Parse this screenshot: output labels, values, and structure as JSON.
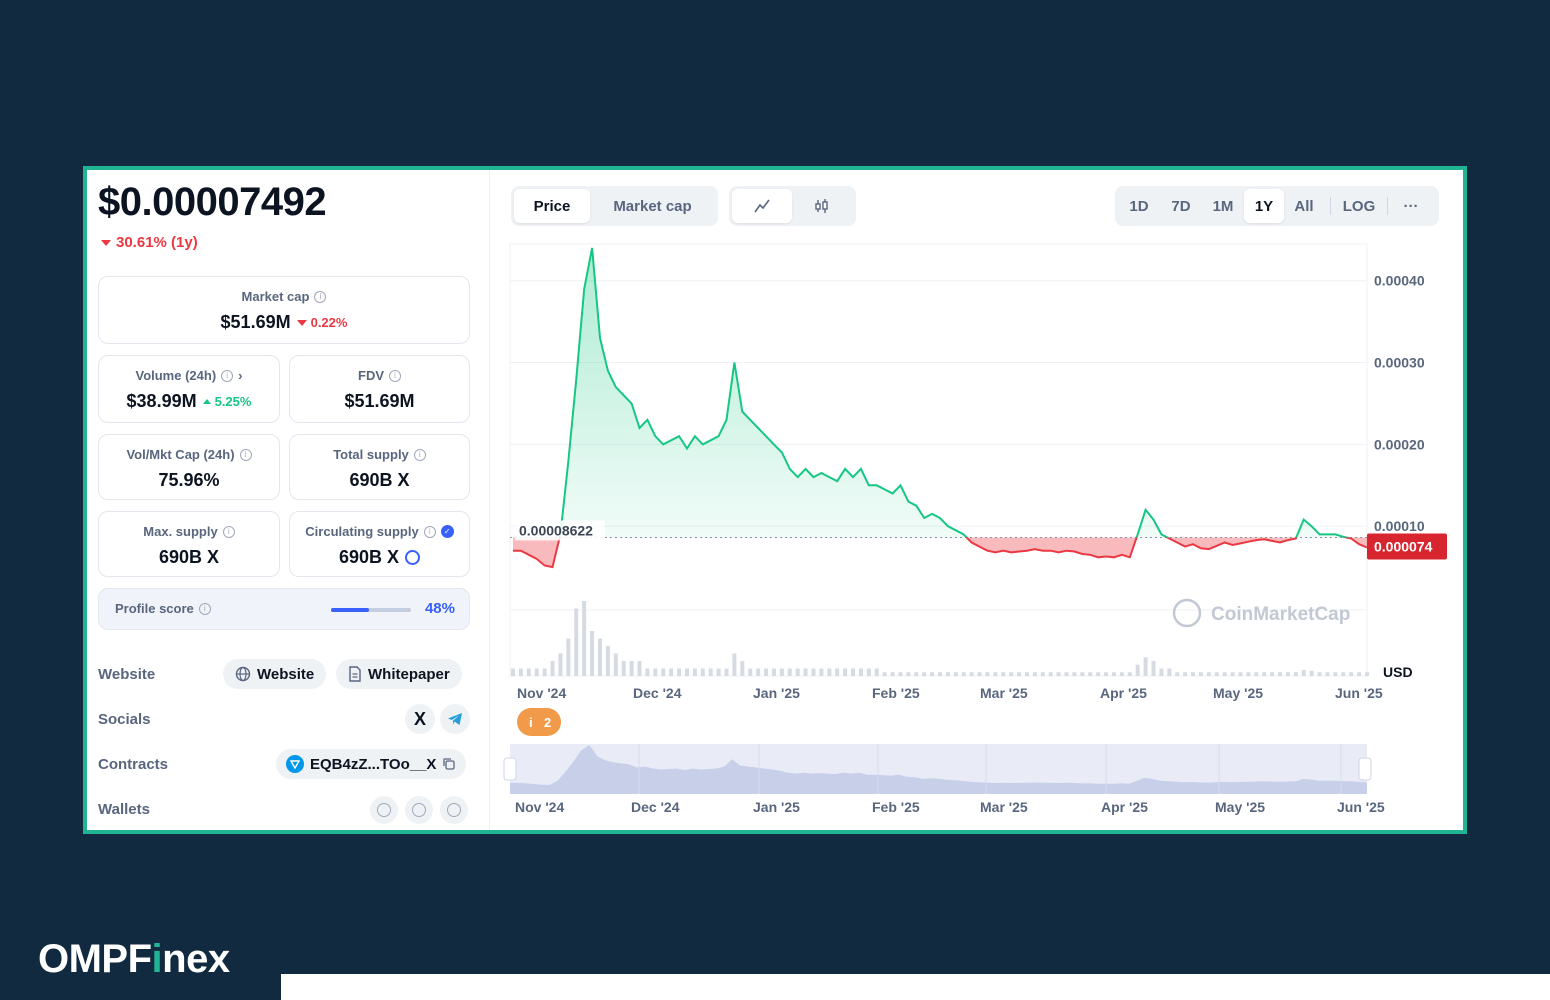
{
  "summary": {
    "price": "$0.00007492",
    "change_1y": "30.61% (1y)"
  },
  "stats": {
    "market_cap": {
      "label": "Market cap",
      "value": "$51.69M",
      "change": "0.22%"
    },
    "volume": {
      "label": "Volume (24h)",
      "value": "$38.99M",
      "change": "5.25%"
    },
    "fdv": {
      "label": "FDV",
      "value": "$51.69M"
    },
    "vol_mkt_cap": {
      "label": "Vol/Mkt Cap (24h)",
      "value": "75.96%"
    },
    "total_supply": {
      "label": "Total supply",
      "value": "690B X"
    },
    "max_supply": {
      "label": "Max. supply",
      "value": "690B X"
    },
    "circulating_supply": {
      "label": "Circulating supply",
      "value": "690B X"
    },
    "profile_score": {
      "label": "Profile score",
      "value": "48%",
      "fraction": 0.48
    }
  },
  "links": {
    "website_label": "Website",
    "website_btn": "Website",
    "whitepaper_btn": "Whitepaper",
    "socials_label": "Socials",
    "contracts_label": "Contracts",
    "contract_address": "EQB4zZ...TOo__X",
    "wallets_label": "Wallets"
  },
  "toolbar": {
    "tab_price": "Price",
    "tab_market_cap": "Market cap",
    "ranges": [
      "1D",
      "7D",
      "1M",
      "1Y",
      "All"
    ],
    "active_range": "1Y",
    "log_label": "LOG",
    "more_label": "···"
  },
  "chart_data": {
    "type": "area",
    "y_axis_labels": [
      "0.00040",
      "0.00030",
      "0.00020",
      "0.00010"
    ],
    "x_axis_labels": [
      "Nov '24",
      "Dec '24",
      "Jan '25",
      "Feb '25",
      "Mar '25",
      "Apr '25",
      "May '25",
      "Jun '25"
    ],
    "navigator_labels": [
      "Nov '24",
      "Dec '24",
      "Jan '25",
      "Feb '25",
      "Mar '25",
      "Apr '25",
      "May '25",
      "Jun '25"
    ],
    "currency": "USD",
    "baseline_value": 8.622e-05,
    "baseline_label": "0.00008622",
    "current_label": "0.000074",
    "watermark": "CoinMarketCap",
    "event_badge": "2",
    "ylim": [
      0,
      0.00044
    ],
    "series": [
      {
        "values": [
          7e-05,
          7e-05,
          6.5e-05,
          6e-05,
          5.2e-05,
          5e-05,
          9e-05,
          0.00018,
          0.00028,
          0.00039,
          0.00044,
          0.00033,
          0.00029,
          0.00027,
          0.00026,
          0.00025,
          0.00022,
          0.00023,
          0.00021,
          0.0002,
          0.000205,
          0.00021,
          0.000195,
          0.00021,
          0.0002,
          0.000205,
          0.00021,
          0.00023,
          0.0003,
          0.00024,
          0.00023,
          0.00022,
          0.00021,
          0.0002,
          0.00019,
          0.00017,
          0.00016,
          0.00017,
          0.00016,
          0.000165,
          0.00016,
          0.000155,
          0.00017,
          0.00016,
          0.00017,
          0.00015,
          0.00015,
          0.000145,
          0.00014,
          0.00015,
          0.00013,
          0.000125,
          0.00011,
          0.000115,
          0.00011,
          0.0001,
          9.5e-05,
          9e-05,
          8e-05,
          7.5e-05,
          7e-05,
          6.8e-05,
          7e-05,
          6.8e-05,
          6.9e-05,
          7e-05,
          7.2e-05,
          7e-05,
          7e-05,
          6.8e-05,
          7e-05,
          6.9e-05,
          6.6e-05,
          6.5e-05,
          6.2e-05,
          6.3e-05,
          6.2e-05,
          6.5e-05,
          6.2e-05,
          9e-05,
          0.00012,
          0.000108,
          9e-05,
          8.5e-05,
          8e-05,
          7.5e-05,
          7.8e-05,
          7.3e-05,
          7.2e-05,
          7.6e-05,
          8e-05,
          7.7e-05,
          7.9e-05,
          8.1e-05,
          8.3e-05,
          8.4e-05,
          8.2e-05,
          8e-05,
          8.3e-05,
          8.5e-05,
          0.000108,
          0.0001,
          9e-05,
          9e-05,
          9e-05,
          8.7e-05,
          8.5e-05,
          7.8e-05,
          7.4e-05
        ],
        "volume": [
          0.1,
          0.1,
          0.1,
          0.1,
          0.1,
          0.2,
          0.3,
          0.5,
          0.9,
          1.0,
          0.6,
          0.5,
          0.4,
          0.3,
          0.2,
          0.2,
          0.2,
          0.1,
          0.1,
          0.1,
          0.1,
          0.1,
          0.1,
          0.1,
          0.1,
          0.1,
          0.1,
          0.1,
          0.3,
          0.2,
          0.1,
          0.1,
          0.1,
          0.1,
          0.1,
          0.1,
          0.1,
          0.1,
          0.1,
          0.1,
          0.1,
          0.1,
          0.1,
          0.1,
          0.1,
          0.1,
          0.1,
          0.05,
          0.05,
          0.05,
          0.05,
          0.05,
          0.05,
          0.05,
          0.05,
          0.05,
          0.05,
          0.05,
          0.05,
          0.05,
          0.05,
          0.05,
          0.05,
          0.05,
          0.05,
          0.05,
          0.05,
          0.05,
          0.05,
          0.05,
          0.05,
          0.05,
          0.05,
          0.05,
          0.05,
          0.05,
          0.05,
          0.05,
          0.05,
          0.15,
          0.25,
          0.2,
          0.1,
          0.1,
          0.05,
          0.05,
          0.05,
          0.05,
          0.05,
          0.05,
          0.05,
          0.05,
          0.05,
          0.05,
          0.05,
          0.05,
          0.05,
          0.05,
          0.05,
          0.05,
          0.08,
          0.07,
          0.05,
          0.05,
          0.05,
          0.05,
          0.05,
          0.05,
          0.05
        ]
      }
    ]
  },
  "brand": {
    "prefix": "OMPF",
    "accent": "i",
    "suffix": "nex"
  }
}
